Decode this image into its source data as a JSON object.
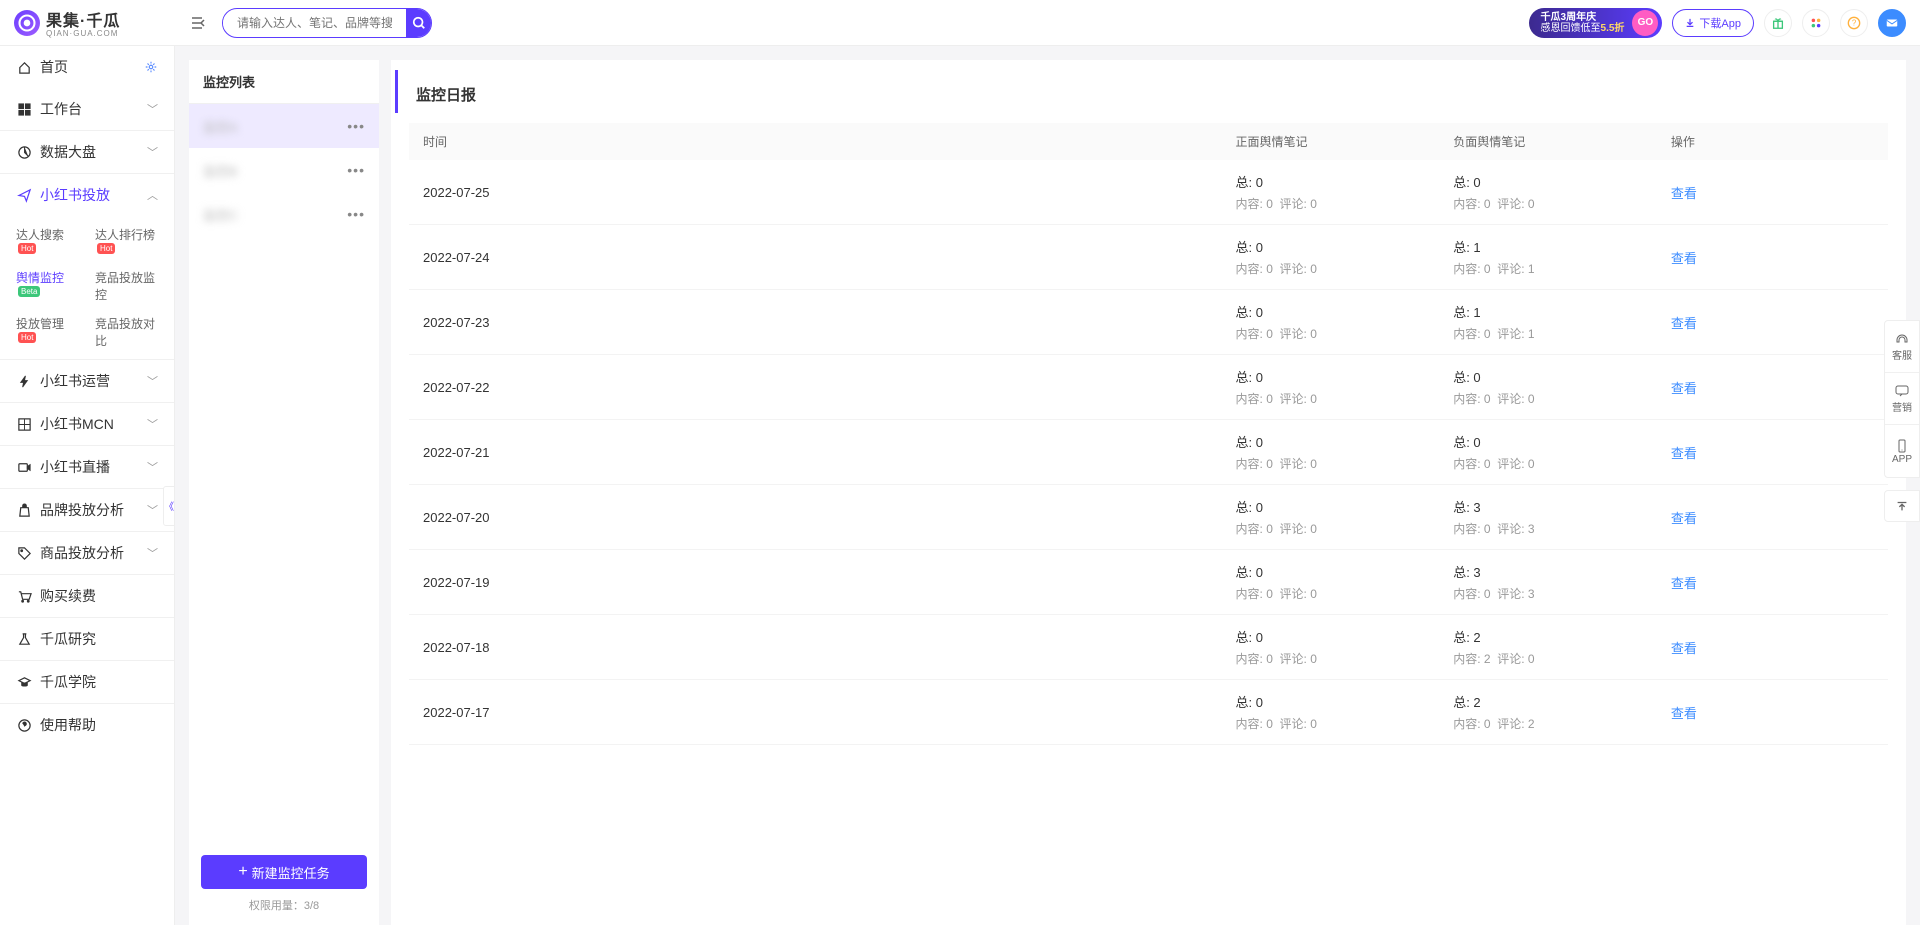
{
  "header": {
    "brand_main": "果集·千瓜",
    "brand_sub": "QIAN·GUA.COM",
    "search_placeholder": "请输入达人、笔记、品牌等搜索",
    "promo_line1": "千瓜3周年庆",
    "promo_line2_pre": "感恩回馈低至",
    "promo_line2_em": "5.5折",
    "promo_go": "GO",
    "download": "下载App"
  },
  "sidebar": {
    "items": [
      {
        "label": "首页",
        "icon": "home",
        "gear": true
      },
      {
        "label": "工作台",
        "icon": "dashboard",
        "chev": true,
        "border": true
      },
      {
        "label": "数据大盘",
        "icon": "pie",
        "chev": true,
        "border": true
      },
      {
        "label": "小红书投放",
        "icon": "send",
        "chev": true,
        "active": true,
        "expanded": true
      },
      {
        "label": "小红书运营",
        "icon": "bolt",
        "chev": true,
        "border": true
      },
      {
        "label": "小红书MCN",
        "icon": "grid",
        "chev": true,
        "border": true
      },
      {
        "label": "小红书直播",
        "icon": "video",
        "chev": true,
        "border": true
      },
      {
        "label": "品牌投放分析",
        "icon": "bag",
        "chev": true,
        "border": true
      },
      {
        "label": "商品投放分析",
        "icon": "tag",
        "chev": true,
        "border": true
      },
      {
        "label": "购买续费",
        "icon": "cart",
        "border": true
      },
      {
        "label": "千瓜研究",
        "icon": "flask",
        "border": true
      },
      {
        "label": "千瓜学院",
        "icon": "cap",
        "border": true
      },
      {
        "label": "使用帮助",
        "icon": "help"
      }
    ],
    "sub": [
      {
        "label": "达人搜索",
        "badge": "Hot",
        "bclass": "hot"
      },
      {
        "label": "达人排行榜",
        "badge": "Hot",
        "bclass": "hot"
      },
      {
        "label": "舆情监控",
        "badge": "Beta",
        "bclass": "beta",
        "active": true
      },
      {
        "label": "竞品投放监控"
      },
      {
        "label": "投放管理",
        "badge": "Hot",
        "bclass": "hot"
      },
      {
        "label": "竞品投放对比"
      }
    ]
  },
  "monitor": {
    "title": "监控列表",
    "items": [
      {
        "name": "监控A",
        "active": true
      },
      {
        "name": "监控B"
      },
      {
        "name": "监控C"
      }
    ],
    "new_task": "新建监控任务",
    "quota_label": "权限用量：",
    "quota_value": "3/8"
  },
  "report": {
    "title": "监控日报",
    "columns": {
      "date": "时间",
      "pos": "正面舆情笔记",
      "neg": "负面舆情笔记",
      "act": "操作"
    },
    "view_label": "查看",
    "total_label": "总: ",
    "content_label": "内容: ",
    "comment_label": "评论: ",
    "rows": [
      {
        "date": "2022-07-25",
        "pt": 0,
        "pc": 0,
        "pm": 0,
        "nt": 0,
        "nc": 0,
        "nm": 0
      },
      {
        "date": "2022-07-24",
        "pt": 0,
        "pc": 0,
        "pm": 0,
        "nt": 1,
        "nc": 0,
        "nm": 1
      },
      {
        "date": "2022-07-23",
        "pt": 0,
        "pc": 0,
        "pm": 0,
        "nt": 1,
        "nc": 0,
        "nm": 1
      },
      {
        "date": "2022-07-22",
        "pt": 0,
        "pc": 0,
        "pm": 0,
        "nt": 0,
        "nc": 0,
        "nm": 0
      },
      {
        "date": "2022-07-21",
        "pt": 0,
        "pc": 0,
        "pm": 0,
        "nt": 0,
        "nc": 0,
        "nm": 0
      },
      {
        "date": "2022-07-20",
        "pt": 0,
        "pc": 0,
        "pm": 0,
        "nt": 3,
        "nc": 0,
        "nm": 3
      },
      {
        "date": "2022-07-19",
        "pt": 0,
        "pc": 0,
        "pm": 0,
        "nt": 3,
        "nc": 0,
        "nm": 3
      },
      {
        "date": "2022-07-18",
        "pt": 0,
        "pc": 0,
        "pm": 0,
        "nt": 2,
        "nc": 2,
        "nm": 0
      },
      {
        "date": "2022-07-17",
        "pt": 0,
        "pc": 0,
        "pm": 0,
        "nt": 2,
        "nc": 0,
        "nm": 2
      }
    ]
  },
  "float": {
    "kf": "客服",
    "yx": "营销",
    "app": "APP"
  }
}
